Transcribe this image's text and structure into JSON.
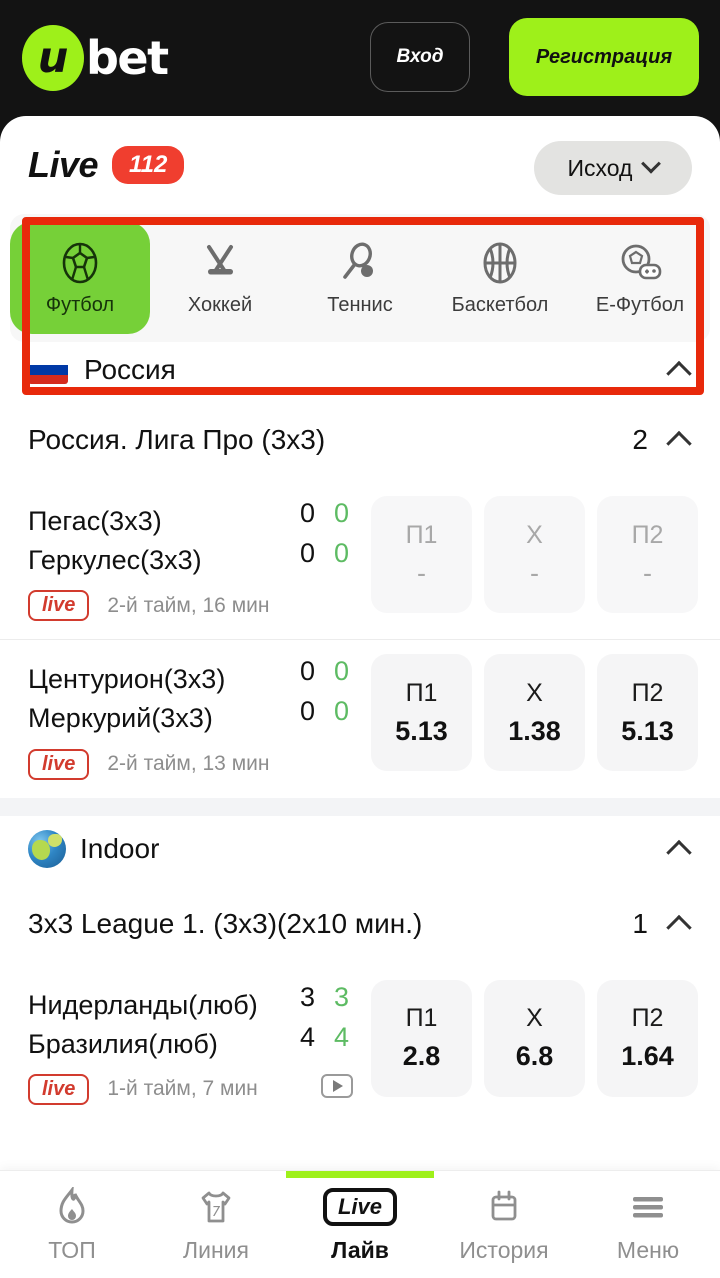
{
  "header": {
    "logo_u": "u",
    "logo_text": "bet",
    "login_label": "Вход",
    "register_label": "Регистрация"
  },
  "live_bar": {
    "title": "Live",
    "count": "112",
    "outcome_label": "Исход",
    "chevron_icon": "chevron-down-icon"
  },
  "sport_tabs": [
    {
      "label": "Футбол",
      "icon": "soccer-ball-icon",
      "active": true
    },
    {
      "label": "Хоккей",
      "icon": "hockey-sticks-icon",
      "active": false
    },
    {
      "label": "Теннис",
      "icon": "tennis-racket-icon",
      "active": false
    },
    {
      "label": "Баскетбол",
      "icon": "basketball-icon",
      "active": false
    },
    {
      "label": "Е-Футбол",
      "icon": "esports-ball-icon",
      "active": false
    }
  ],
  "sections": [
    {
      "country": "Россия",
      "flag_icon": "russia-flag-icon",
      "league": "Россия. Лига Про (3х3)",
      "league_count": "2",
      "matches": [
        {
          "home": "Пегас(3х3)",
          "away": "Геркулес(3х3)",
          "home_score": "0",
          "away_score": "0",
          "home_score_sub": "0",
          "away_score_sub": "0",
          "live_label": "live",
          "status": "2-й тайм, 16 мин",
          "has_stream": false,
          "odds": [
            {
              "key": "П1",
              "value": "-"
            },
            {
              "key": "X",
              "value": "-"
            },
            {
              "key": "П2",
              "value": "-"
            }
          ],
          "odds_disabled": true
        },
        {
          "home": "Центурион(3х3)",
          "away": "Меркурий(3х3)",
          "home_score": "0",
          "away_score": "0",
          "home_score_sub": "0",
          "away_score_sub": "0",
          "live_label": "live",
          "status": "2-й тайм, 13 мин",
          "has_stream": false,
          "odds": [
            {
              "key": "П1",
              "value": "5.13"
            },
            {
              "key": "X",
              "value": "1.38"
            },
            {
              "key": "П2",
              "value": "5.13"
            }
          ],
          "odds_disabled": false
        }
      ]
    },
    {
      "country": "Indoor",
      "flag_icon": "globe-icon",
      "league": "3x3 League 1. (3х3)(2x10 мин.)",
      "league_count": "1",
      "matches": [
        {
          "home": "Нидерланды(люб)",
          "away": "Бразилия(люб)",
          "home_score": "3",
          "away_score": "4",
          "home_score_sub": "3",
          "away_score_sub": "4",
          "live_label": "live",
          "status": "1-й тайм, 7 мин",
          "has_stream": true,
          "stream_icon": "play-video-icon",
          "odds": [
            {
              "key": "П1",
              "value": "2.8"
            },
            {
              "key": "X",
              "value": "6.8"
            },
            {
              "key": "П2",
              "value": "1.64"
            }
          ],
          "odds_disabled": false
        }
      ]
    }
  ],
  "bottom_nav": [
    {
      "label": "ТОП",
      "icon": "fire-icon",
      "active": false
    },
    {
      "label": "Линия",
      "icon": "jersey-icon",
      "active": false
    },
    {
      "label": "Лайв",
      "icon": "live-badge-icon",
      "active": true
    },
    {
      "label": "История",
      "icon": "calendar-icon",
      "active": false
    },
    {
      "label": "Меню",
      "icon": "hamburger-icon",
      "active": false
    }
  ],
  "colors": {
    "brand_green": "#9ef01a",
    "tab_active_green": "#76d038",
    "live_red": "#f03e2f",
    "annotation_red": "#e8290b",
    "dark_bg": "#131313",
    "score_green": "#5dbb63"
  }
}
